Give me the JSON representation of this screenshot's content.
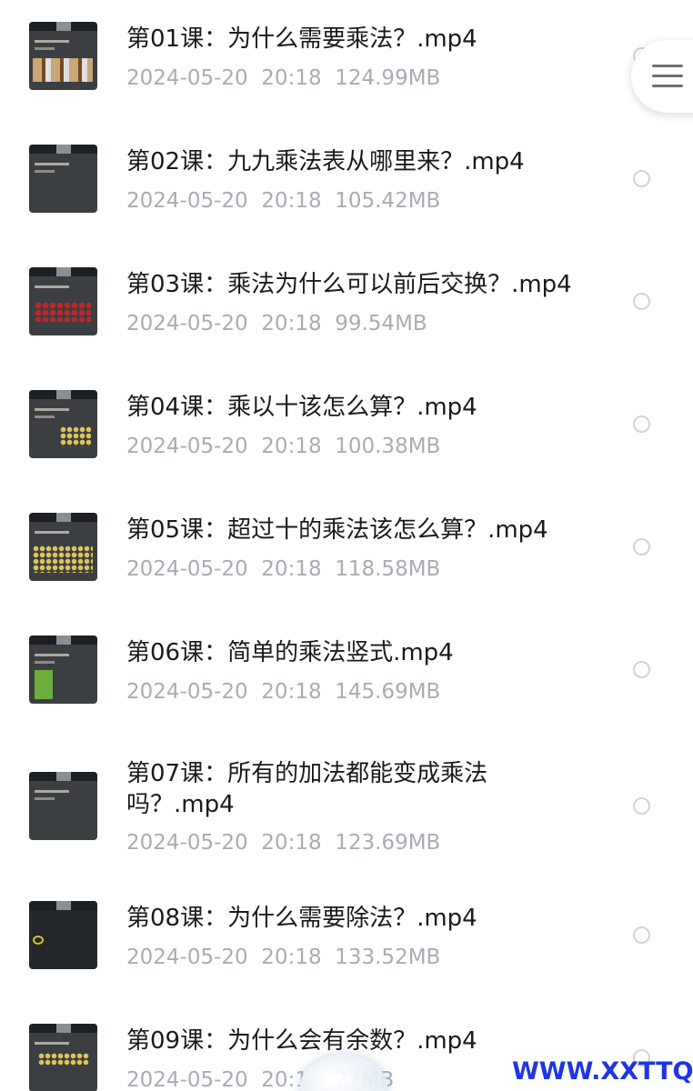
{
  "files": [
    {
      "title": "第01课：为什么需要乘法？.mp4",
      "date": "2024-05-20",
      "time": "20:18",
      "size": "124.99MB",
      "thumb": "wood"
    },
    {
      "title": "第02课：九九乘法表从哪里来？.mp4",
      "date": "2024-05-20",
      "time": "20:18",
      "size": "105.42MB",
      "thumb": "plain"
    },
    {
      "title": "第03课：乘法为什么可以前后交换？.mp4",
      "date": "2024-05-20",
      "time": "20:18",
      "size": "99.54MB",
      "thumb": "red"
    },
    {
      "title": "第04课：乘以十该怎么算？.mp4",
      "date": "2024-05-20",
      "time": "20:18",
      "size": "100.38MB",
      "thumb": "yellow"
    },
    {
      "title": "第05课：超过十的乘法该怎么算？.mp4",
      "date": "2024-05-20",
      "time": "20:18",
      "size": "118.58MB",
      "thumb": "yellow"
    },
    {
      "title": "第06课：简单的乘法竖式.mp4",
      "date": "2024-05-20",
      "time": "20:18",
      "size": "145.69MB",
      "thumb": "green"
    },
    {
      "title": "第07课：所有的加法都能变成乘法吗？.mp4",
      "date": "2024-05-20",
      "time": "20:18",
      "size": "123.69MB",
      "thumb": "plain"
    },
    {
      "title": "第08课：为什么需要除法？.mp4",
      "date": "2024-05-20",
      "time": "20:18",
      "size": "133.52MB",
      "thumb": "dark"
    },
    {
      "title": "第09课：为什么会有余数？.mp4",
      "date": "2024-05-20",
      "time": "20:1",
      "size": "27MB",
      "thumb": "yellow"
    }
  ],
  "menu_icon": "hamburger-menu-icon",
  "watermark": "WWW.XXTTQ.COM",
  "colors": {
    "title": "#1a1a1a",
    "meta": "#a8adb3",
    "radio_border": "#cfd3d8",
    "watermark": "#1e35e6"
  }
}
